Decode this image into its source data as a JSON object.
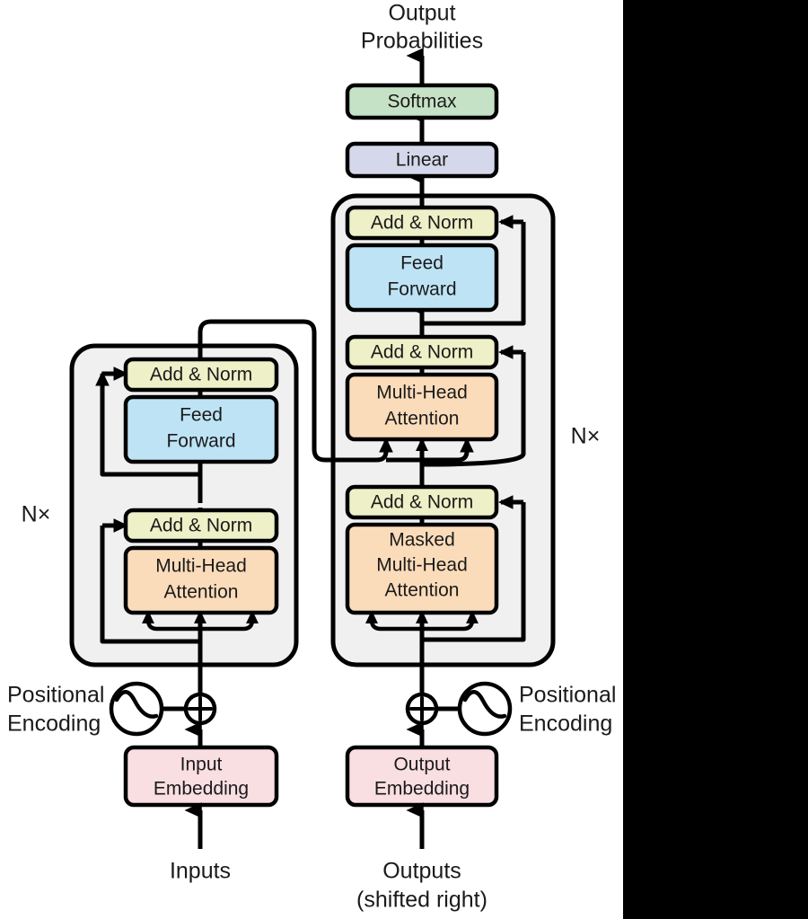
{
  "figure": {
    "title": "Transformer model architecture",
    "background_color": "#ffffff"
  },
  "palette": {
    "softmax": "#c6e2c6",
    "linear": "#d5d8ea",
    "add_norm": "#eef0c8",
    "feed_forward": "#bee3f5",
    "attention": "#fbdcba",
    "embedding": "#f9dee2",
    "panel": "#f0f0f0",
    "stroke": "#000000",
    "occluder": "#000000"
  },
  "top": {
    "output_probabilities_line1": "Output",
    "output_probabilities_line2": "Probabilities",
    "softmax_label": "Softmax",
    "linear_label": "Linear"
  },
  "encoder": {
    "stack_label": "N×",
    "blocks": [
      {
        "label": "Add & Norm",
        "name": "encoder-add-norm-top"
      },
      {
        "label_line1": "Feed",
        "label_line2": "Forward",
        "name": "encoder-feed-forward"
      },
      {
        "label": "Add & Norm",
        "name": "encoder-add-norm-bottom"
      },
      {
        "label_line1": "Multi-Head",
        "label_line2": "Attention",
        "name": "encoder-multi-head-attention"
      }
    ]
  },
  "decoder": {
    "stack_label": "N×",
    "blocks": [
      {
        "label": "Add & Norm",
        "name": "decoder-add-norm-top"
      },
      {
        "label_line1": "Feed",
        "label_line2": "Forward",
        "name": "decoder-feed-forward"
      },
      {
        "label": "Add & Norm",
        "name": "decoder-add-norm-middle"
      },
      {
        "label_line1": "Multi-Head",
        "label_line2": "Attention",
        "name": "decoder-cross-attention"
      },
      {
        "label": "Add & Norm",
        "name": "decoder-add-norm-bottom"
      },
      {
        "label_line1": "Masked",
        "label_line2": "Multi-Head",
        "label_line3": "Attention",
        "name": "decoder-masked-attention"
      }
    ]
  },
  "inputs_side": {
    "positional_encoding_line1": "Positional",
    "positional_encoding_line2": "Encoding",
    "embedding_line1": "Input",
    "embedding_line2": "Embedding",
    "source_label": "Inputs"
  },
  "outputs_side": {
    "positional_encoding_line1": "Positional",
    "positional_encoding_line2": "Encoding",
    "embedding_line1": "Output",
    "embedding_line2": "Embedding",
    "source_line1": "Outputs",
    "source_line2": "(shifted right)"
  }
}
